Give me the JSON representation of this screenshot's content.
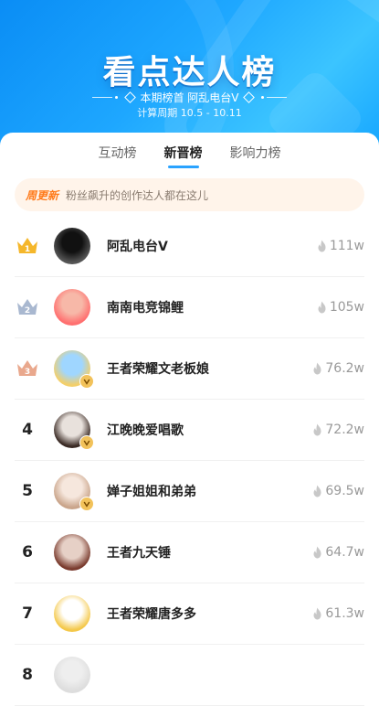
{
  "header": {
    "title": "看点达人榜",
    "leader_text": "本期榜首 阿乱电台V",
    "period_text": "计算周期 10.5 - 10.11"
  },
  "tabs": [
    {
      "label": "互动榜",
      "active": false
    },
    {
      "label": "新晋榜",
      "active": true
    },
    {
      "label": "影响力榜",
      "active": false
    }
  ],
  "notice": {
    "tag": "周更新",
    "text": "粉丝飙升的创作达人都在这儿"
  },
  "icons": {
    "crown": "crown-icon",
    "verified": "verified-badge-icon",
    "heat": "flame-icon"
  },
  "colors": {
    "gold": "#f5b72b",
    "silver": "#a9b8d0",
    "bronze": "#e9a88d",
    "accent": "#2aa3ff",
    "notice_tag": "#ff7a1a"
  },
  "ranking": [
    {
      "rank": "1",
      "name": "阿乱电台V",
      "score": "111w",
      "medal": "gold",
      "verified": false
    },
    {
      "rank": "2",
      "name": "南南电竞锦鲤",
      "score": "105w",
      "medal": "silver",
      "verified": false
    },
    {
      "rank": "3",
      "name": "王者荣耀文老板娘",
      "score": "76.2w",
      "medal": "bronze",
      "verified": true
    },
    {
      "rank": "4",
      "name": "江晚晚爱唱歌",
      "score": "72.2w",
      "medal": "",
      "verified": true
    },
    {
      "rank": "5",
      "name": "婵子姐姐和弟弟",
      "score": "69.5w",
      "medal": "",
      "verified": true
    },
    {
      "rank": "6",
      "name": "王者九天锤",
      "score": "64.7w",
      "medal": "",
      "verified": false
    },
    {
      "rank": "7",
      "name": "王者荣耀唐多多",
      "score": "61.3w",
      "medal": "",
      "verified": false
    },
    {
      "rank": "8",
      "name": "",
      "score": "",
      "medal": "",
      "verified": false
    }
  ]
}
